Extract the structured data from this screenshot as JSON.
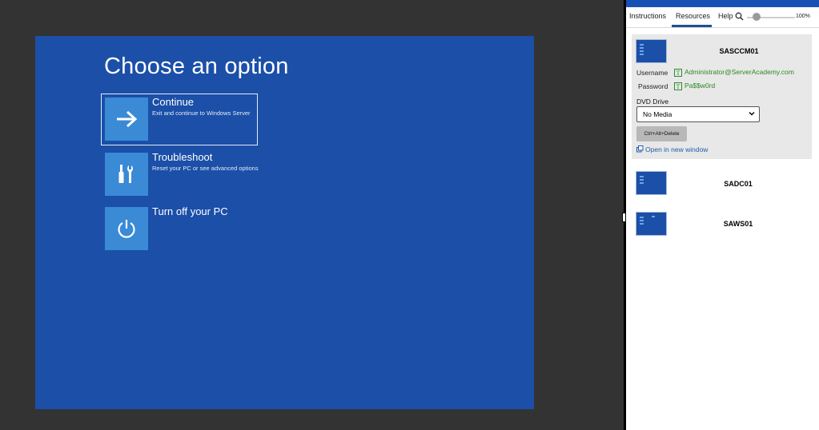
{
  "vm_console": {
    "title": "Choose an option",
    "options": [
      {
        "title": "Continue",
        "description": "Exit and continue to Windows Server",
        "icon": "arrow-right-icon",
        "selected": true
      },
      {
        "title": "Troubleshoot",
        "description": "Reset your PC or see advanced options",
        "icon": "tools-icon",
        "selected": false
      },
      {
        "title": "Turn off your PC",
        "description": "",
        "icon": "power-icon",
        "selected": false
      }
    ]
  },
  "panel": {
    "tabs": {
      "instructions": "Instructions",
      "resources": "Resources",
      "help": "Help"
    },
    "active_tab": "Resources",
    "zoom": {
      "value": "100%",
      "level": 0.2,
      "icon": "magnifier-icon"
    },
    "machines": [
      {
        "name": "SASCCM01",
        "expanded": true,
        "username_label": "Username",
        "username": "Administrator@ServerAcademy.com",
        "password_label": "Password",
        "password": "Pa$$w0rd",
        "type_icon_glyph": "T",
        "dvd_label": "DVD Drive",
        "dvd_selected": "No Media",
        "cad_button": "Ctrl+Alt+Delete",
        "open_link": "Open in new window"
      },
      {
        "name": "SADC01",
        "expanded": false
      },
      {
        "name": "SAWS01",
        "expanded": false
      }
    ]
  },
  "colors": {
    "vm_background": "#1b4fa8",
    "tile": "#3a8ad6",
    "panel_accent": "#1750b4",
    "credential_green": "#2b8a1f",
    "link_blue": "#1f5ca8"
  }
}
